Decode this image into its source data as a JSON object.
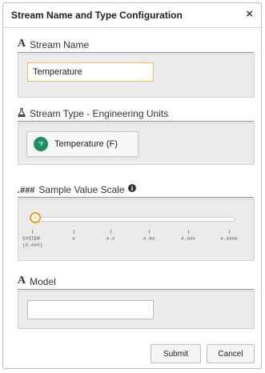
{
  "dialog": {
    "title": "Stream Name and Type Configuration",
    "close_symbol": "×"
  },
  "stream_name": {
    "header_icon": "A",
    "header_label": "Stream Name",
    "value": "Temperature"
  },
  "stream_type": {
    "header_icon": "flask-icon",
    "header_label": "Stream Type - Engineering Units",
    "badge": "°F",
    "selected_label": "Temperature (F)"
  },
  "scale": {
    "header_icon": ".###",
    "header_label": "Sample Value Scale",
    "info_icon": "info-icon",
    "selected_index": 0,
    "ticks": [
      "SYSTEM",
      "#",
      "#.#",
      "#.##",
      "#.###",
      "#.####"
    ],
    "first_tick_sub": "(#.###)",
    "accent_color": "#f0a030"
  },
  "model": {
    "header_icon": "A",
    "header_label": "Model",
    "value": ""
  },
  "footer": {
    "submit_label": "Submit",
    "cancel_label": "Cancel"
  }
}
